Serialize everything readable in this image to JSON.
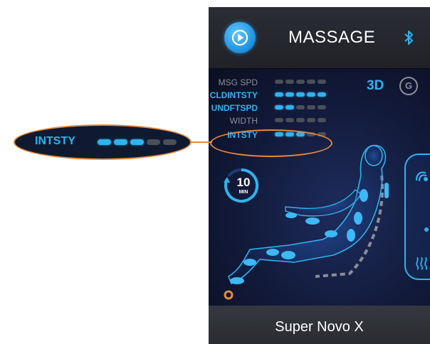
{
  "header": {
    "title": "MASSAGE",
    "play_icon": "play-circle-icon",
    "bluetooth_icon": "bluetooth-icon"
  },
  "settings": [
    {
      "label": "MSG SPD",
      "level": 0,
      "max": 5,
      "active": false
    },
    {
      "label": "CLDINTSTY",
      "level": 5,
      "max": 5,
      "active": true
    },
    {
      "label": "UNDFTSPD",
      "level": 2,
      "max": 5,
      "active": true
    },
    {
      "label": "WIDTH",
      "level": 0,
      "max": 5,
      "active": false
    },
    {
      "label": "INTSTY",
      "level": 3,
      "max": 5,
      "active": true
    }
  ],
  "mode": {
    "three_d": "3D",
    "g_badge": "G"
  },
  "timer": {
    "value": "10",
    "unit": "MIN"
  },
  "footer": {
    "model": "Super Novo X"
  },
  "callout": {
    "label": "INTSTY",
    "level": 3,
    "max": 5
  },
  "colors": {
    "accent": "#2fb3ee",
    "callout_outline": "#e58a3a",
    "inactive_dot": "#4a4f58"
  }
}
